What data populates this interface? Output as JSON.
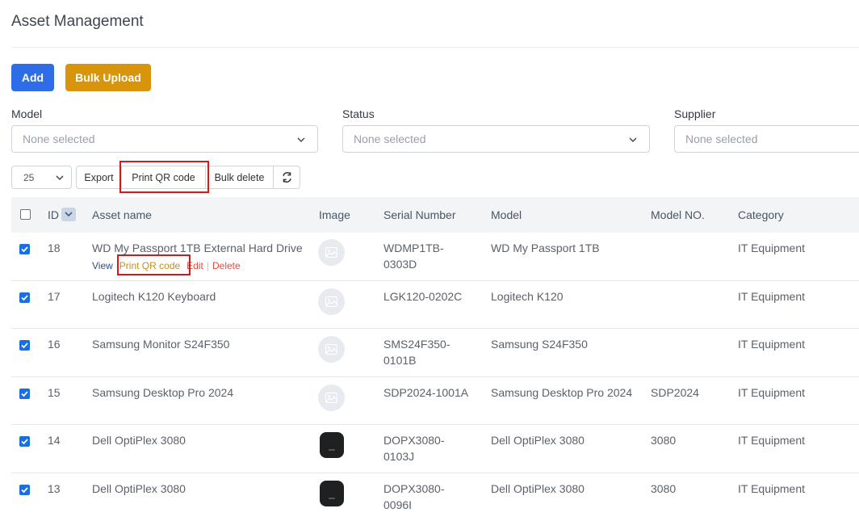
{
  "page": {
    "title": "Asset Management"
  },
  "actions": {
    "add_label": "Add",
    "bulk_upload_label": "Bulk Upload"
  },
  "filters": [
    {
      "label": "Model",
      "value": "None selected"
    },
    {
      "label": "Status",
      "value": "None selected"
    },
    {
      "label": "Supplier",
      "value": "None selected"
    }
  ],
  "toolbar": {
    "page_size": "25",
    "export_label": "Export",
    "print_qr_label": "Print QR code",
    "bulk_delete_label": "Bulk delete",
    "refresh_icon": "refresh-icon"
  },
  "table": {
    "columns": [
      "ID",
      "Asset name",
      "Image",
      "Serial Number",
      "Model",
      "Model NO.",
      "Category"
    ],
    "row_actions": {
      "view": "View",
      "print_qr": "Print QR code",
      "edit": "Edit",
      "delete": "Delete"
    },
    "rows": [
      {
        "id": "18",
        "name": "WD My Passport 1TB External Hard Drive",
        "image": "placeholder",
        "serial_line1": "WDMP1TB-",
        "serial_line2": "0303D",
        "model": "WD My Passport 1TB",
        "model_no": "",
        "category": "IT Equipment",
        "checked": true
      },
      {
        "id": "17",
        "name": "Logitech K120 Keyboard",
        "image": "placeholder",
        "serial_line1": "LGK120-0202C",
        "serial_line2": "",
        "model": "Logitech K120",
        "model_no": "",
        "category": "IT Equipment",
        "checked": true
      },
      {
        "id": "16",
        "name": "Samsung Monitor S24F350",
        "image": "placeholder",
        "serial_line1": "SMS24F350-",
        "serial_line2": "0101B",
        "model": "Samsung S24F350",
        "model_no": "",
        "category": "IT Equipment",
        "checked": true
      },
      {
        "id": "15",
        "name": "Samsung Desktop Pro 2024",
        "image": "placeholder",
        "serial_line1": "SDP2024-1001A",
        "serial_line2": "",
        "model": "Samsung Desktop Pro 2024",
        "model_no": "SDP2024",
        "category": "IT Equipment",
        "checked": true
      },
      {
        "id": "14",
        "name": "Dell OptiPlex 3080",
        "image": "photo",
        "serial_line1": "DOPX3080-",
        "serial_line2": "0103J",
        "model": "Dell OptiPlex 3080",
        "model_no": "3080",
        "category": "IT Equipment",
        "checked": true
      },
      {
        "id": "13",
        "name": "Dell OptiPlex 3080",
        "image": "photo",
        "serial_line1": "DOPX3080-",
        "serial_line2": "0096I",
        "model": "Dell OptiPlex 3080",
        "model_no": "3080",
        "category": "IT Equipment",
        "checked": true
      }
    ]
  },
  "colors": {
    "primary": "#2f6de8",
    "warning": "#d8950b",
    "highlight": "#d4191c",
    "checkbox": "#1a6fe0"
  }
}
